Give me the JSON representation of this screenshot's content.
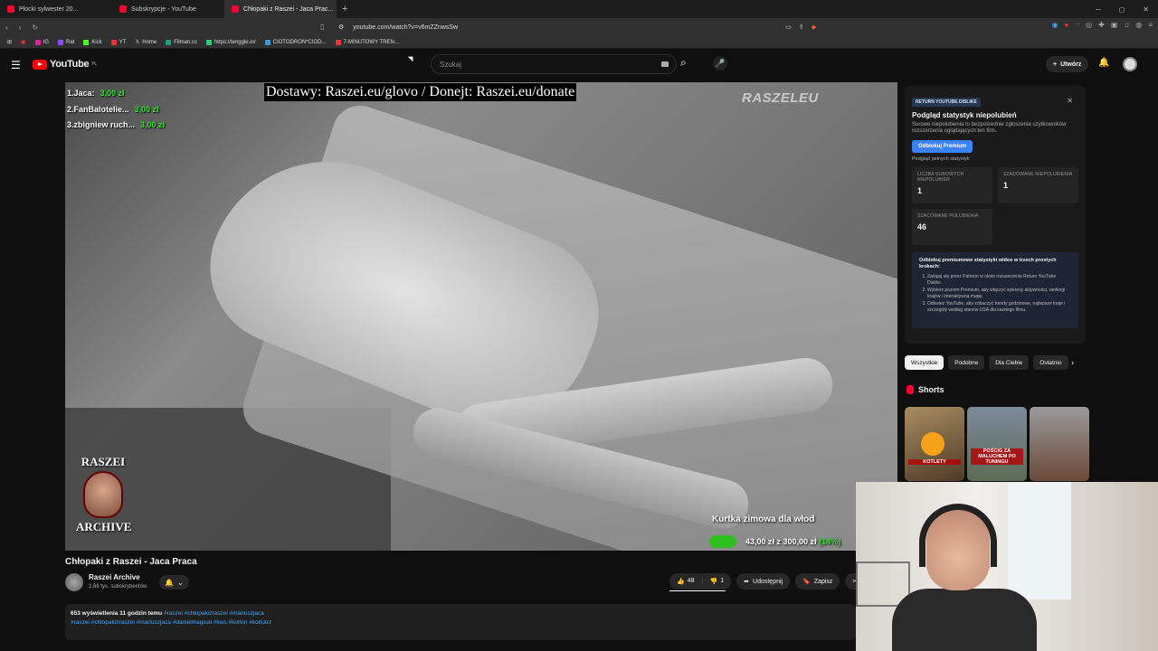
{
  "browser": {
    "tabs": [
      {
        "label": "Płocki sylwester 20..."
      },
      {
        "label": "Subskrypcje - YouTube"
      },
      {
        "label": "Chłopaki z Raszei - Jaca Prac..."
      }
    ],
    "url": "youtube.com/watch?v=v6mZZnwsSw",
    "bookmarks": [
      "IG",
      "Rat",
      "Kick",
      "YT",
      "Home",
      "Filman.cc",
      "https://tenggle.io/",
      "CIOTODRON*CIOD...",
      "7-MINUTOWY TREN..."
    ]
  },
  "header": {
    "logo_text": "YouTube",
    "region": "PL",
    "search_placeholder": "Szukaj",
    "create_label": "Utwórz"
  },
  "video": {
    "overlay_top": "Dostawy: Raszei.eu/glovo / Donejt: Raszei.eu/donate",
    "donors": [
      {
        "name": "1.Jaca:",
        "amount": "3,00 zł"
      },
      {
        "name": "2.FanBalotelie...",
        "amount": "3,00 zł"
      },
      {
        "name": "3.zbigniew ruch...",
        "amount": "3,00 zł"
      }
    ],
    "watermark": "RASZELEU",
    "badge_top": "RASZEI",
    "badge_bottom": "ARCHIVE",
    "goal_title": "Kurtka zimowa dla włod",
    "goal_amount": "43,00 zł z 300,00 zł",
    "goal_percent": "(14%)",
    "goal_progress": 0.14,
    "title": "Chłopaki z Raszei - Jaca Praca"
  },
  "channel": {
    "name": "Raszei Archive",
    "subs": "2,66 tys. subskrybentów"
  },
  "actions": {
    "likes": "48",
    "dislikes": "1",
    "share": "Udostępnij",
    "save": "Zapisz"
  },
  "description": {
    "stats": "653 wyświetlenia  11 godzin temu",
    "hashtags1": "#raszei #chłopakizraszei #mariuszjaca",
    "hashtags2": "#raszei #chlopakizraszei #mariuszjaca #danielmagical #kws #korkin #korkarz"
  },
  "rytd": {
    "tag": "RETURN YOUTUBE DISLIKE",
    "title": "Podgląd statystyk niepolubień",
    "subtitle": "Surowe niepolubienia to bezpośrednie zgłoszenia użytkowników rozszerzenia oglądających ten film.",
    "unlock_label": "Odblokuj Premium",
    "full_stats": "Podgląd pełnych statystyk",
    "stat1_label": "LICZBA SUROWYCH NIEPOLUBIEŃ",
    "stat1_value": "1",
    "stat2_label": "SZACOWANE NIEPOLUBIENIA",
    "stat2_value": "1",
    "stat3_label": "SZACOWANE POLUBIENIA",
    "stat3_value": "46",
    "steps_title": "Odblokuj premiumowe statystyki wideo w trzech prostych krokach:",
    "steps": [
      "Zaloguj się przez Patreon w oknie rozszerzenia Return YouTube Dislike.",
      "Wybierz poziom Premium, aby włączyć wykresy aktywności, rankingi krajów i interaktywną mapę.",
      "Odśwież YouTube, aby zobaczyć trendy godzinowe, najlepsze kraje i szczegóły według stanów USA dla każdego filmu."
    ]
  },
  "chips": [
    "Wszystkie",
    "Podobne",
    "Dla Ciebie",
    "Ostatnio"
  ],
  "shorts": {
    "heading": "Shorts",
    "items": [
      {
        "caption": "KOTLETY"
      },
      {
        "caption": "POŚCIG ZA MALUCHEM PO TUNINGU"
      },
      {
        "caption": ""
      }
    ]
  },
  "colors": {
    "accent": "#ff0000",
    "donor_amount": "#32e02c",
    "unlock": "#3b82f6"
  }
}
